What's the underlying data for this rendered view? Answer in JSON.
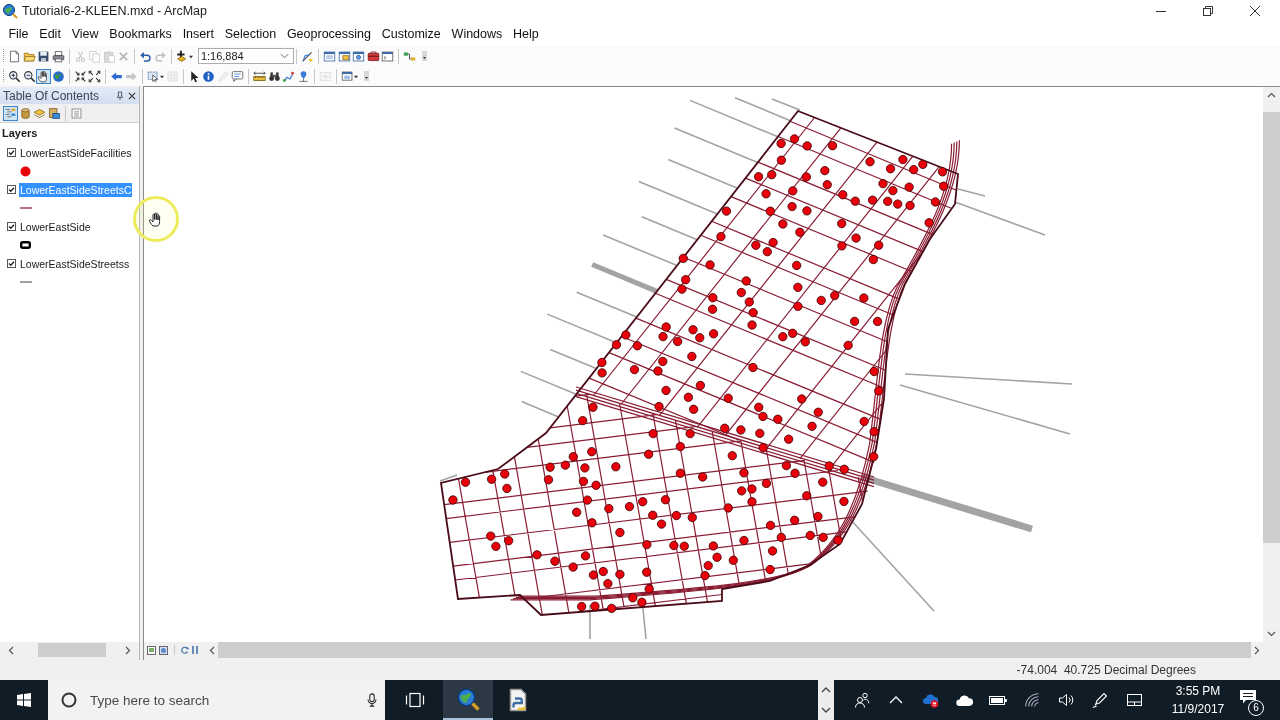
{
  "window": {
    "title": "Tutorial6-2-KLEEN.mxd - ArcMap"
  },
  "menu": [
    "File",
    "Edit",
    "View",
    "Bookmarks",
    "Insert",
    "Selection",
    "Geoprocessing",
    "Customize",
    "Windows",
    "Help"
  ],
  "standard_toolbar": {
    "groups": [
      [
        {
          "kind": "new",
          "disabled": false
        },
        {
          "kind": "open",
          "disabled": false
        },
        {
          "kind": "save",
          "disabled": false
        },
        {
          "kind": "print",
          "disabled": false
        }
      ],
      [
        {
          "kind": "cut",
          "disabled": true
        },
        {
          "kind": "copy",
          "disabled": true
        },
        {
          "kind": "paste",
          "disabled": true
        },
        {
          "kind": "delete",
          "disabled": true
        }
      ],
      [
        {
          "kind": "undo",
          "disabled": false
        },
        {
          "kind": "redo",
          "disabled": true
        }
      ],
      [
        {
          "kind": "adddata",
          "disabled": false
        },
        {
          "kind": "scale",
          "disabled": false,
          "value": "1:16,884"
        }
      ],
      [
        {
          "kind": "editor",
          "disabled": false
        }
      ],
      [
        {
          "kind": "toc",
          "disabled": false
        },
        {
          "kind": "catalog",
          "disabled": false
        },
        {
          "kind": "searchwin",
          "disabled": false
        },
        {
          "kind": "toolbox",
          "disabled": false
        },
        {
          "kind": "python",
          "disabled": false
        }
      ],
      [
        {
          "kind": "model",
          "disabled": false
        }
      ]
    ]
  },
  "tools_toolbar": {
    "groups": [
      [
        {
          "kind": "zoomin",
          "selected": false,
          "disabled": false
        },
        {
          "kind": "zoomout",
          "selected": false,
          "disabled": false
        },
        {
          "kind": "pan",
          "selected": true,
          "disabled": false
        },
        {
          "kind": "fullextent",
          "selected": false,
          "disabled": false
        }
      ],
      [
        {
          "kind": "fixedin",
          "selected": false,
          "disabled": false
        },
        {
          "kind": "fixedout",
          "selected": false,
          "disabled": false
        }
      ],
      [
        {
          "kind": "back",
          "selected": false,
          "disabled": false
        },
        {
          "kind": "forward",
          "selected": false,
          "disabled": true
        }
      ],
      [
        {
          "kind": "selectfeatures",
          "selected": false,
          "disabled": false
        },
        {
          "kind": "clearselect",
          "selected": false,
          "disabled": true
        }
      ],
      [
        {
          "kind": "selectelements",
          "selected": false,
          "disabled": false
        },
        {
          "kind": "identify",
          "selected": false,
          "disabled": false
        },
        {
          "kind": "editpencil",
          "selected": false,
          "disabled": true
        },
        {
          "kind": "popup",
          "selected": false,
          "disabled": false
        }
      ],
      [
        {
          "kind": "measure",
          "selected": false,
          "disabled": false
        },
        {
          "kind": "find",
          "selected": false,
          "disabled": false
        },
        {
          "kind": "route",
          "selected": false,
          "disabled": false
        },
        {
          "kind": "xy",
          "selected": false,
          "disabled": false
        }
      ],
      [
        {
          "kind": "timeslider",
          "selected": false,
          "disabled": true
        }
      ],
      [
        {
          "kind": "viewer",
          "selected": false,
          "disabled": false
        }
      ]
    ]
  },
  "toc": {
    "title": "Table Of Contents",
    "tools": [
      {
        "kind": "drawingorder",
        "selected": true
      },
      {
        "kind": "source",
        "selected": false
      },
      {
        "kind": "visibility",
        "selected": false
      },
      {
        "kind": "selection",
        "selected": false
      },
      {
        "kind": "options",
        "selected": false
      }
    ],
    "root": "Layers",
    "layers": [
      {
        "name": "LowerEastSideFacilities",
        "checked": true,
        "selected": false,
        "symbol": {
          "kind": "point",
          "color": "#e8000b"
        }
      },
      {
        "name": "LowerEastSideStreetsC",
        "checked": true,
        "selected": true,
        "symbol": {
          "kind": "line",
          "color": "#b86f7e"
        }
      },
      {
        "name": "LowerEastSide",
        "checked": true,
        "selected": false,
        "symbol": {
          "kind": "polygon",
          "color": "#000000"
        }
      },
      {
        "name": "LowerEastSideStreetss",
        "checked": true,
        "selected": false,
        "symbol": {
          "kind": "line",
          "color": "#a0a0a0"
        }
      }
    ]
  },
  "status_bar": {
    "coordinates": "-74.004  40.725 Decimal Degrees"
  },
  "taskbar": {
    "search": {
      "placeholder": "Type here to search"
    },
    "apps": [
      {
        "kind": "arcmap",
        "selected": true
      },
      {
        "kind": "pythonfile",
        "selected": false
      }
    ],
    "clock": {
      "time": "3:55 PM",
      "date": "11/9/2017"
    },
    "notifications": {
      "count": "6"
    }
  }
}
